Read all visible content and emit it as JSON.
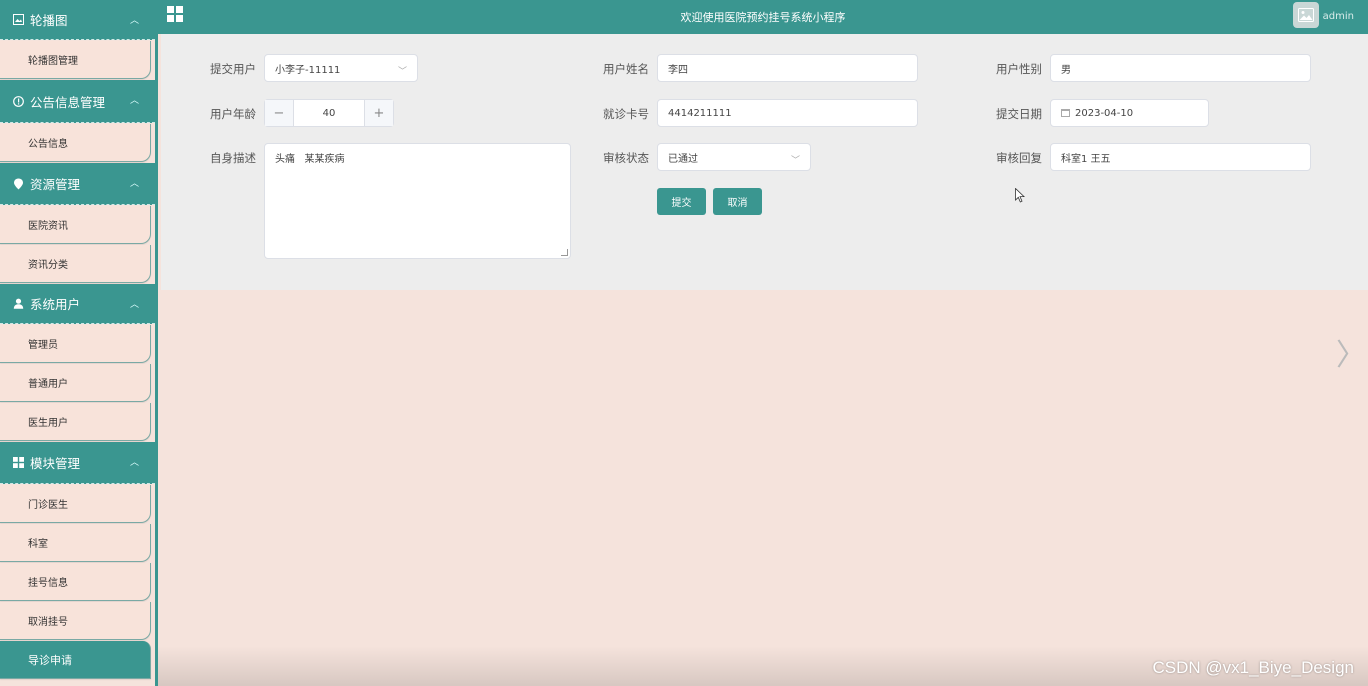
{
  "header": {
    "title": "欢迎使用医院预约挂号系统小程序",
    "user": "admin"
  },
  "sidebar": {
    "groups": [
      {
        "label": "轮播图",
        "icon": "image-icon",
        "items": [
          "轮播图管理"
        ]
      },
      {
        "label": "公告信息管理",
        "icon": "info-circle-icon",
        "items": [
          "公告信息"
        ]
      },
      {
        "label": "资源管理",
        "icon": "location-pin-icon",
        "items": [
          "医院资讯",
          "资讯分类"
        ]
      },
      {
        "label": "系统用户",
        "icon": "user-icon",
        "items": [
          "管理员",
          "普通用户",
          "医生用户"
        ]
      },
      {
        "label": "模块管理",
        "icon": "grid-icon",
        "items": [
          "门诊医生",
          "科室",
          "挂号信息",
          "取消挂号",
          "导诊申请"
        ]
      }
    ],
    "active_item": "导诊申请"
  },
  "form": {
    "submit_user": {
      "label": "提交用户",
      "value": "小李子-11111"
    },
    "user_name": {
      "label": "用户姓名",
      "value": "李四"
    },
    "user_gender": {
      "label": "用户性别",
      "value": "男"
    },
    "user_age": {
      "label": "用户年龄",
      "value": "40",
      "minus": "−",
      "plus": "+"
    },
    "card_no": {
      "label": "就诊卡号",
      "value": "4414211111"
    },
    "submit_date": {
      "label": "提交日期",
      "value": "2023-04-10"
    },
    "description": {
      "label": "自身描述",
      "value": "头痛   某某疾病"
    },
    "review_status": {
      "label": "审核状态",
      "value": "已通过"
    },
    "review_reply": {
      "label": "审核回复",
      "value": "科室1 王五"
    },
    "submit_button": "提交",
    "cancel_button": "取消"
  },
  "watermark": "CSDN @vx1_Biye_Design",
  "colors": {
    "primary": "#3a9690",
    "page_bg": "#f5e3dc",
    "panel_bg": "#ededed"
  }
}
